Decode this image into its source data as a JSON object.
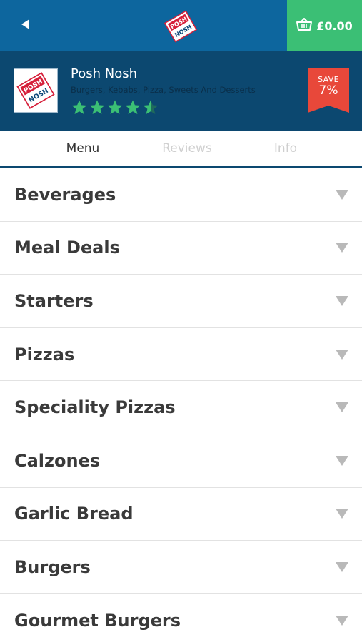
{
  "topbar": {
    "back_icon": "back-arrow-icon",
    "basket_icon": "basket-icon",
    "basket_total": "£0.00",
    "logo_text_line1": "POSH",
    "logo_text_line2": "NOSH",
    "bar_color": "#0d669e",
    "basket_color": "#3bbf75"
  },
  "restaurant": {
    "name": "Posh Nosh",
    "cuisine": "Burgers, Kebabs, Pizza, Sweets And Desserts",
    "rating": 4.5,
    "rating_max": 5,
    "star_color": "#3bbf75",
    "save_label": "SAVE",
    "save_percent": "7%",
    "badge_color": "#e8483a",
    "header_color": "#0c4870"
  },
  "tabs": [
    {
      "label": "Menu",
      "active": true
    },
    {
      "label": "Reviews",
      "active": false
    },
    {
      "label": "Info",
      "active": false
    }
  ],
  "categories": [
    {
      "label": "Beverages"
    },
    {
      "label": "Meal Deals"
    },
    {
      "label": "Starters"
    },
    {
      "label": "Pizzas"
    },
    {
      "label": "Speciality Pizzas"
    },
    {
      "label": "Calzones"
    },
    {
      "label": "Garlic Bread"
    },
    {
      "label": "Burgers"
    },
    {
      "label": "Gourmet Burgers"
    }
  ]
}
